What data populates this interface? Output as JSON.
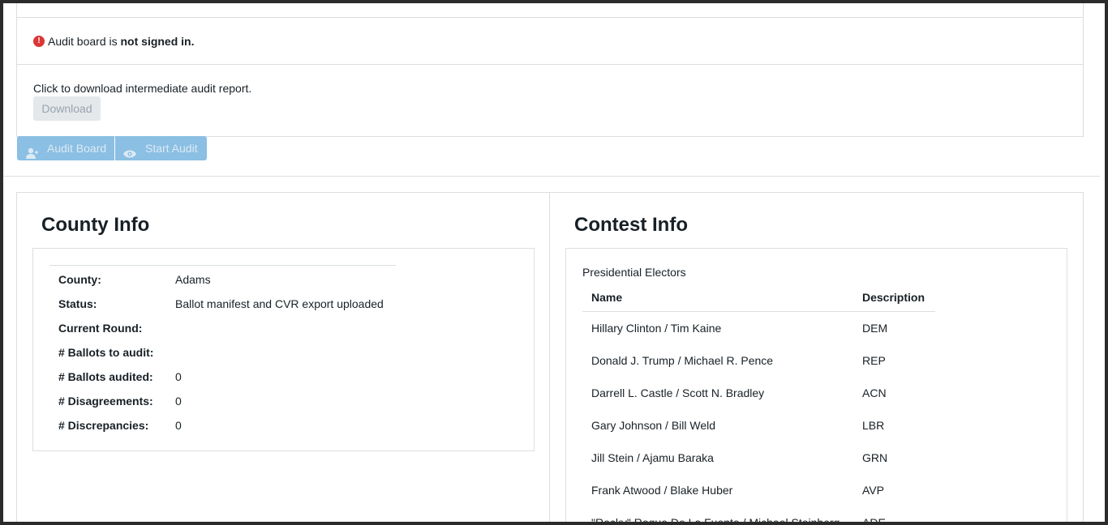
{
  "signin": {
    "prefix": "Audit board is ",
    "status": "not signed in.",
    "icon": "error-icon"
  },
  "download": {
    "label": "Click to download intermediate audit report.",
    "button": "Download"
  },
  "actions": {
    "audit_board": "Audit Board",
    "start_audit": "Start Audit"
  },
  "county_info": {
    "title": "County Info",
    "rows": [
      {
        "key": "County:",
        "value": "Adams"
      },
      {
        "key": "Status:",
        "value": "Ballot manifest and CVR export uploaded"
      },
      {
        "key": "Current Round:",
        "value": ""
      },
      {
        "key": "# Ballots to audit:",
        "value": ""
      },
      {
        "key": "# Ballots audited:",
        "value": "0"
      },
      {
        "key": "# Disagreements:",
        "value": "0"
      },
      {
        "key": "# Discrepancies:",
        "value": "0"
      }
    ]
  },
  "contest_info": {
    "title": "Contest Info",
    "contest_name": "Presidential Electors",
    "columns": [
      "Name",
      "Description"
    ],
    "rows": [
      {
        "name": "Hillary Clinton / Tim Kaine",
        "desc": "DEM"
      },
      {
        "name": "Donald J. Trump / Michael R. Pence",
        "desc": "REP"
      },
      {
        "name": "Darrell L. Castle / Scott N. Bradley",
        "desc": "ACN"
      },
      {
        "name": "Gary Johnson / Bill Weld",
        "desc": "LBR"
      },
      {
        "name": "Jill Stein / Ajamu Baraka",
        "desc": "GRN"
      },
      {
        "name": "Frank Atwood / Blake Huber",
        "desc": "AVP"
      },
      {
        "name": "\"Rocky\" Roque De La Fuente / Michael Steinberg",
        "desc": "ADE"
      }
    ]
  },
  "colors": {
    "accent_disabled": "#8bbfe3",
    "error": "#db3737",
    "border": "#dbdee0"
  }
}
